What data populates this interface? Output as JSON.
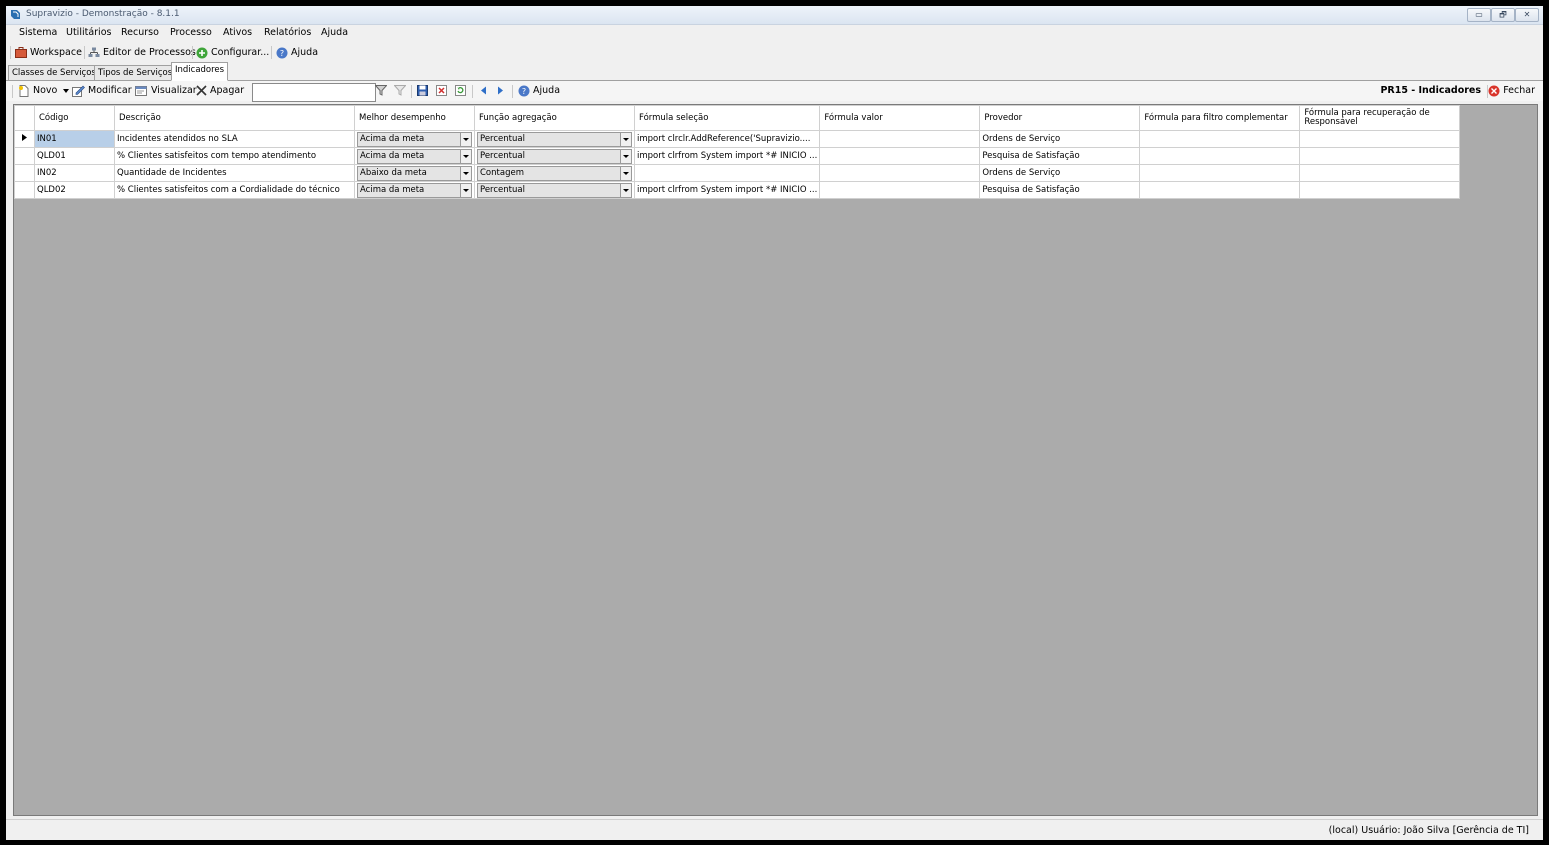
{
  "window": {
    "title": "Supravizio - Demonstração - 8.1.1",
    "minimize": "▭",
    "restore": "🗗",
    "close": "✕"
  },
  "menu": [
    "Sistema",
    "Utilitários",
    "Recurso",
    "Processo",
    "Ativos",
    "Relatórios",
    "Ajuda"
  ],
  "toolbar1": {
    "workspace": "Workspace",
    "editor": "Editor de Processos",
    "configurar": "Configurar...",
    "ajuda": "Ajuda"
  },
  "tabs": [
    "Classes de Serviços",
    "Tipos de Serviços",
    "Indicadores"
  ],
  "toolbar2": {
    "novo": "Novo",
    "modificar": "Modificar",
    "visualizar": "Visualizar",
    "apagar": "Apagar",
    "search_value": "",
    "ajuda": "Ajuda",
    "page_title": "PR15 - Indicadores",
    "fechar": "Fechar"
  },
  "grid": {
    "columns": [
      "Código",
      "Descrição",
      "Melhor desempenho",
      "Função agregação",
      "Fórmula seleção",
      "Fórmula valor",
      "Provedor",
      "Fórmula para filtro complementar",
      "Fórmula para recuperação de Responsável"
    ],
    "rows": [
      {
        "codigo": "IN01",
        "descricao": "Incidentes atendidos no SLA",
        "melhor": "Acima da meta",
        "funcao": "Percentual",
        "selecao": "import clrclr.AddReference('Supravizio....",
        "valor": "",
        "provedor": "Ordens de Serviço",
        "filtro": "",
        "responsavel": ""
      },
      {
        "codigo": "QLD01",
        "descricao": "% Clientes satisfeitos com tempo atendimento",
        "melhor": "Acima da meta",
        "funcao": "Percentual",
        "selecao": "import clrfrom System import *# INICIO ...",
        "valor": "",
        "provedor": "Pesquisa de Satisfação",
        "filtro": "",
        "responsavel": ""
      },
      {
        "codigo": "IN02",
        "descricao": "Quantidade de Incidentes",
        "melhor": "Abaixo da meta",
        "funcao": "Contagem",
        "selecao": "",
        "valor": "",
        "provedor": "Ordens de Serviço",
        "filtro": "",
        "responsavel": ""
      },
      {
        "codigo": "QLD02",
        "descricao": "% Clientes satisfeitos com a Cordialidade do técnico",
        "melhor": "Acima da meta",
        "funcao": "Percentual",
        "selecao": "import clrfrom System import *# INICIO ...",
        "valor": "",
        "provedor": "Pesquisa de Satisfação",
        "filtro": "",
        "responsavel": ""
      }
    ]
  },
  "status": {
    "text": "(local)  Usuário: João Silva [Gerência de TI]"
  },
  "colors": {
    "selected_cell": "#b8cfe8",
    "grid_bg": "#ababab",
    "close_red": "#d9342b"
  }
}
